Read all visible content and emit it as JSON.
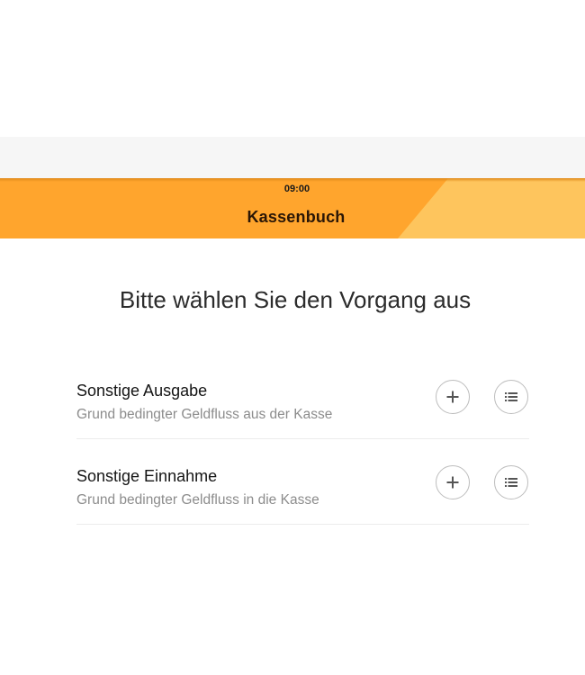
{
  "status_bar": {
    "time": "09:00"
  },
  "header": {
    "title": "Kassenbuch",
    "colors": {
      "band": "#ffa52d",
      "band_light": "#fec55d",
      "title_text": "#2a1606"
    }
  },
  "prompt": "Bitte wählen Sie den Vorgang aus",
  "transactions": [
    {
      "title": "Sonstige Ausgabe",
      "subtitle": "Grund bedingter Geldfluss aus der Kasse",
      "add_icon": "plus-icon",
      "list_icon": "list-icon"
    },
    {
      "title": "Sonstige Einnahme",
      "subtitle": "Grund bedingter Geldfluss in die Kasse",
      "add_icon": "plus-icon",
      "list_icon": "list-icon"
    }
  ]
}
